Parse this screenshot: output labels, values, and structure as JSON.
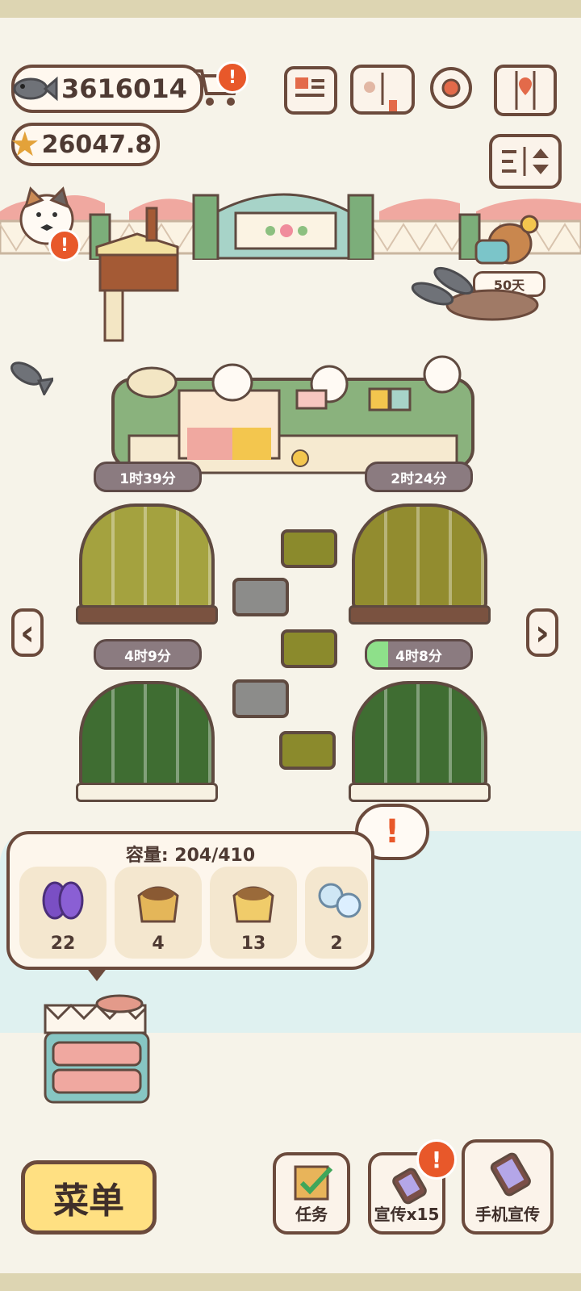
{
  "currencies": {
    "fish": "3616014",
    "stars": "26047.8"
  },
  "alerts": {
    "badge_symbol": "!"
  },
  "visitor": {
    "days_label": "50天"
  },
  "timers": [
    {
      "text": "1时39分",
      "progress": 0
    },
    {
      "text": "2时24分",
      "progress": 0
    },
    {
      "text": "4时9分",
      "progress": 0
    },
    {
      "text": "4时8分",
      "progress": 0.2
    }
  ],
  "navigation": {
    "left_arrow": "‹",
    "right_arrow": "›"
  },
  "storage": {
    "capacity_label": "容量: 204/410",
    "items": [
      {
        "icon": "purple-fish-icon",
        "count": "22",
        "color": "#7a4fc4"
      },
      {
        "icon": "brown-sack-icon",
        "count": "4",
        "color": "#c69245"
      },
      {
        "icon": "yellow-sack-icon",
        "count": "13",
        "color": "#e8c05a"
      },
      {
        "icon": "snowflake-icon",
        "count": "2",
        "color": "#cfe7f5"
      }
    ]
  },
  "bottom_bar": {
    "menu_label": "菜单",
    "tasks_label": "任务",
    "promote_label": "宣传x15",
    "phone_promote_label": "手机宣传"
  },
  "colors": {
    "accent_orange": "#e8582a",
    "menu_yellow": "#ffe082",
    "timer_gray": "#8b7b80",
    "progress_green": "#8ee08a"
  }
}
